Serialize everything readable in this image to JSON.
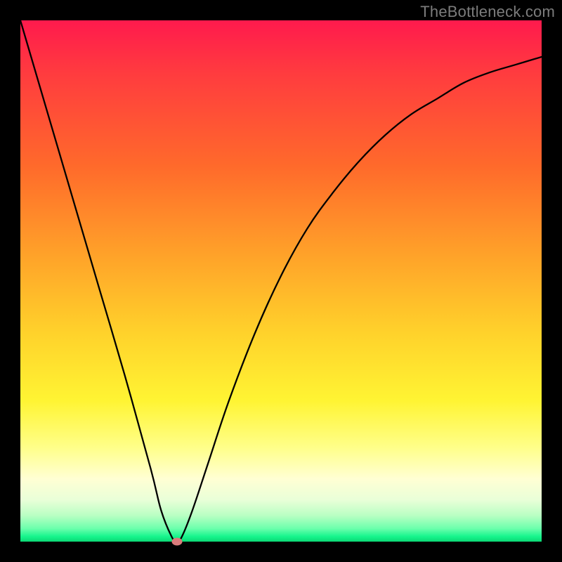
{
  "watermark": "TheBottleneck.com",
  "chart_data": {
    "type": "line",
    "title": "",
    "xlabel": "",
    "ylabel": "",
    "xlim": [
      0,
      100
    ],
    "ylim": [
      0,
      100
    ],
    "grid": false,
    "legend": false,
    "series": [
      {
        "name": "curve",
        "x": [
          0,
          5,
          10,
          15,
          20,
          25,
          27,
          29,
          30,
          31,
          33,
          36,
          40,
          45,
          50,
          55,
          60,
          65,
          70,
          75,
          80,
          85,
          90,
          95,
          100
        ],
        "y": [
          100,
          83,
          66,
          49,
          32,
          14,
          6,
          1,
          0,
          1,
          6,
          15,
          27,
          40,
          51,
          60,
          67,
          73,
          78,
          82,
          85,
          88,
          90,
          91.5,
          93
        ]
      }
    ],
    "marker": {
      "x": 30,
      "y": 0,
      "color": "#d97b7b"
    },
    "gradient_colors": {
      "top": "#ff1a4d",
      "mid_upper": "#ff8f29",
      "mid": "#fff433",
      "mid_lower": "#ffffd4",
      "bottom": "#0bd874"
    }
  }
}
